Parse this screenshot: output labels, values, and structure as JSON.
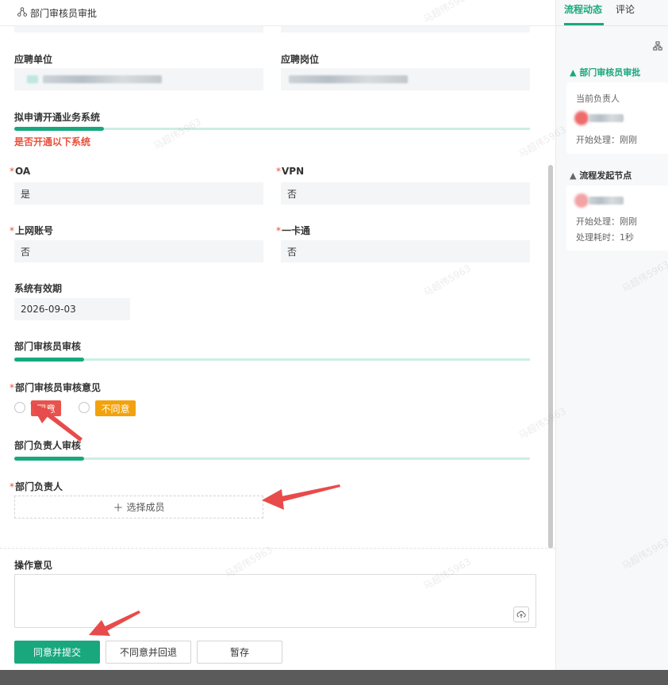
{
  "header": {
    "title": "部门审核员审批"
  },
  "form": {
    "apply_unit_label": "应聘单位",
    "apply_post_label": "应聘岗位",
    "biz_section_title": "拟申请开通业务系统",
    "biz_warning": "是否开通以下系统",
    "oa_label": "OA",
    "oa_value": "是",
    "vpn_label": "VPN",
    "vpn_value": "否",
    "net_label": "上网账号",
    "net_value": "否",
    "card_label": "一卡通",
    "card_value": "否",
    "validity_label": "系统有效期",
    "validity_value": "2026-09-03",
    "review_section_title": "部门审核员审核",
    "review_opinion_label": "部门审核员审核意见",
    "agree_option": "同意",
    "disagree_option": "不同意",
    "head_section_title": "部门负责人审核",
    "head_label": "部门负责人",
    "select_member": "选择成员"
  },
  "footer": {
    "opinion_label": "操作意见",
    "submit_button": "同意并提交",
    "reject_button": "不同意并回退",
    "save_button": "暂存"
  },
  "side": {
    "tab_flow": "流程动态",
    "tab_comment": "评论",
    "current_node_title": "部门审核员审批",
    "current_owner_label": "当前负责人",
    "current_start_text": "开始处理：刚刚",
    "start_node_title": "流程发起节点",
    "start_start_text": "开始处理：刚刚",
    "start_elapsed_text": "处理耗时：1秒"
  },
  "watermark": "马超伟5963",
  "colors": {
    "primary": "#19a87e",
    "danger": "#e8503a",
    "warning": "#f2a20d",
    "arrow": "#e84b4b"
  }
}
